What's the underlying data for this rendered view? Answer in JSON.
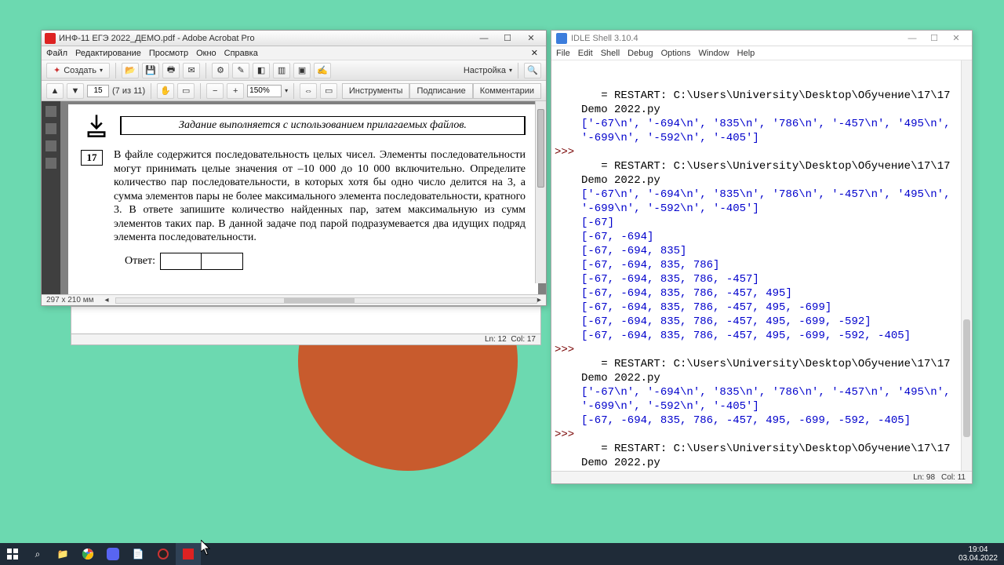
{
  "acrobat": {
    "title": "ИНФ-11 ЕГЭ 2022_ДЕМО.pdf - Adobe Acrobat Pro",
    "menus": [
      "Файл",
      "Редактирование",
      "Просмотр",
      "Окно",
      "Справка"
    ],
    "create_label": "Создать",
    "settings_label": "Настройка",
    "page_num": "15",
    "page_total": "(7 из 11)",
    "zoom": "150%",
    "right_buttons": [
      "Инструменты",
      "Подписание",
      "Комментарии"
    ],
    "banner": "Задание выполняется с использованием прилагаемых файлов.",
    "qnum": "17",
    "qtext": "В файле содержится последовательность целых чисел. Элементы последовательности могут принимать целые значения от –10 000 до 10 000 включительно. Определите количество пар последовательности, в которых хотя бы одно число делится на 3, а сумма элементов пары не более максимального элемента последовательности, кратного 3. В ответе запишите количество найденных пар, затем максимальную из сумм элементов таких пар. В данной задаче под парой подразумевается два идущих подряд элемента последовательности.",
    "answer_label": "Ответ:",
    "page_dim": "297 x 210 мм"
  },
  "bg_status": {
    "ln": "Ln: 12",
    "col": "Col: 17"
  },
  "idle": {
    "title": "IDLE Shell 3.10.4",
    "menus": [
      "File",
      "Edit",
      "Shell",
      "Debug",
      "Options",
      "Window",
      "Help"
    ],
    "restart": "= RESTART: C:\\Users\\University\\Desktop\\Обучение\\17\\17 Demo 2022.py",
    "raw_list": "['-67\\n', '-694\\n', '835\\n', '786\\n', '-457\\n', '495\\n', '-699\\n', '-592\\n', '-405']",
    "lists": [
      "[-67]",
      "[-67, -694]",
      "[-67, -694, 835]",
      "[-67, -694, 835, 786]",
      "[-67, -694, 835, 786, -457]",
      "[-67, -694, 835, 786, -457, 495]",
      "[-67, -694, 835, 786, -457, 495, -699]",
      "[-67, -694, 835, 786, -457, 495, -699, -592]",
      "[-67, -694, 835, 786, -457, 495, -699, -592, -405]"
    ],
    "final_list": "[-67, -694, 835, 786, -457, 495, -699, -592, -405]",
    "prompt": ">>>",
    "status_ln": "Ln: 98",
    "status_col": "Col: 11"
  },
  "taskbar": {
    "time": "19:04",
    "date": "03.04.2022"
  }
}
